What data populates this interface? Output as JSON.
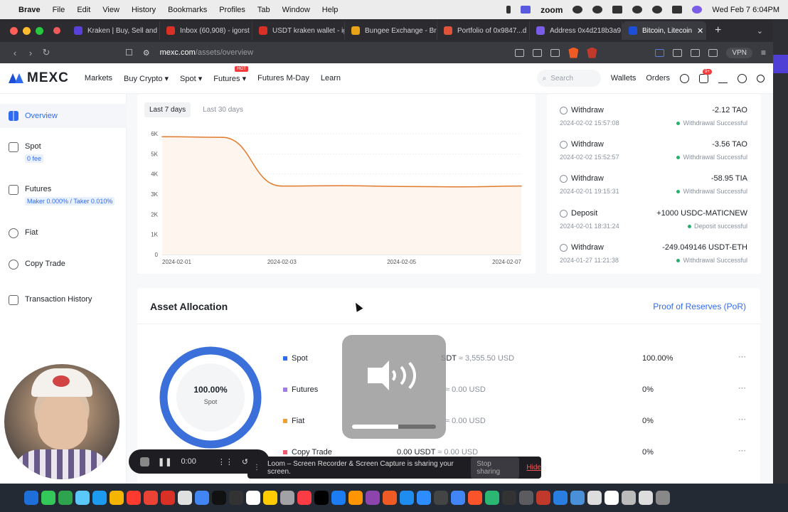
{
  "menubar": {
    "items": [
      "Brave",
      "File",
      "Edit",
      "View",
      "History",
      "Bookmarks",
      "Profiles",
      "Tab",
      "Window",
      "Help"
    ],
    "zoom_label": "zoom",
    "clock": "Wed Feb 7  6:04PM"
  },
  "tabs": [
    {
      "title": "Kraken | Buy, Sell and t",
      "color": "#5841d8"
    },
    {
      "title": "Inbox (60,908) - igorst",
      "color": "#d93025"
    },
    {
      "title": "USDT kraken wallet - ig",
      "color": "#d93025"
    },
    {
      "title": "Bungee Exchange - Bri",
      "color": "#e8a317"
    },
    {
      "title": "Portfolio of 0x9847...d",
      "color": "#e0533b"
    },
    {
      "title": "Address 0x4d218b3a9",
      "color": "#7b5ce6"
    },
    {
      "title": "Bitcoin, Litecoin",
      "color": "#1d4ed8",
      "active": true
    }
  ],
  "address": {
    "host": "mexc.com",
    "path": "/assets/overview",
    "vpn": "VPN"
  },
  "site": {
    "logo": "MEXC",
    "nav": [
      "Markets",
      "Buy Crypto ▾",
      "Spot ▾",
      "Futures ▾",
      "Futures M-Day",
      "Learn"
    ],
    "hot_badge": "HOT",
    "search_placeholder": "Search",
    "wallets": "Wallets",
    "orders": "Orders",
    "msg_badge": "9+"
  },
  "sidebar": [
    {
      "label": "Overview",
      "active": true
    },
    {
      "label": "Spot",
      "sub": "0 fee"
    },
    {
      "label": "Futures",
      "sub": "Maker 0.000% / Taker 0.010%"
    },
    {
      "label": "Fiat"
    },
    {
      "label": "Copy Trade"
    },
    {
      "label": "Transaction History"
    }
  ],
  "range_tabs": {
    "selected": "Last 7 days",
    "other": "Last 30 days"
  },
  "chart_data": {
    "type": "line",
    "x": [
      "2024-02-01",
      "2024-02-02",
      "2024-02-03",
      "2024-02-04",
      "2024-02-05",
      "2024-02-06",
      "2024-02-07"
    ],
    "values": [
      5850,
      5820,
      3400,
      3420,
      3380,
      3360,
      3400
    ],
    "ylim": [
      0,
      6000
    ],
    "yticks": [
      "0",
      "1K",
      "2K",
      "3K",
      "4K",
      "5K",
      "6K"
    ],
    "xtick_labels": [
      "2024-02-01",
      "2024-02-03",
      "2024-02-05",
      "2024-02-07"
    ],
    "color": "#e07b2e"
  },
  "transactions": [
    {
      "type": "Withdraw",
      "date": "2024-02-02 15:57:08",
      "amount": "-2.12 TAO",
      "status": "Withdrawal Successful"
    },
    {
      "type": "Withdraw",
      "date": "2024-02-02 15:52:57",
      "amount": "-3.56 TAO",
      "status": "Withdrawal Successful"
    },
    {
      "type": "Withdraw",
      "date": "2024-02-01 19:15:31",
      "amount": "-58.95 TIA",
      "status": "Withdrawal Successful"
    },
    {
      "type": "Deposit",
      "date": "2024-02-01 18:31:24",
      "amount": "+1000 USDC-MATICNEW",
      "status": "Deposit successful"
    },
    {
      "type": "Withdraw",
      "date": "2024-01-27 11:21:38",
      "amount": "-249.049146 USDT-ETH",
      "status": "Withdrawal Successful"
    }
  ],
  "allocation": {
    "title": "Asset Allocation",
    "por_link": "Proof of Reserves (PoR)",
    "donut_pct": "100.00%",
    "donut_label": "Spot",
    "donut_fraction": 1.0,
    "donut_color": "#3b6fd9",
    "rows": [
      {
        "name": "Spot",
        "value": "SDT",
        "usd": " ≈ 3,555.50 USD",
        "pct": "100.00%",
        "color": "#2f6bf0"
      },
      {
        "name": "Futures",
        "value": "",
        "usd": " ≈ 0.00 USD",
        "pct": "0%",
        "color": "#a27be8"
      },
      {
        "name": "Fiat",
        "value": "",
        "usd": " ≈ 0.00 USD",
        "pct": "0%",
        "color": "#f0a030"
      },
      {
        "name": "Copy Trade",
        "value": "0.00 USDT",
        "usd": " ≈ 0.00 USD",
        "pct": "0%",
        "color": "#ef5a6f"
      }
    ],
    "more": "⋯"
  },
  "volume": {
    "level": 0.55
  },
  "loom": {
    "timer": "0:00",
    "message": "Loom – Screen Recorder & Screen Capture is sharing your screen.",
    "stop": "Stop sharing",
    "hide": "Hide"
  },
  "dock": [
    "#1e6fd9",
    "#34c759",
    "#2ea44f",
    "#5ac8fa",
    "#1d9bf0",
    "#f4b400",
    "#ff3b30",
    "#ea4335",
    "#d93025",
    "#e0e0e0",
    "#4285f4",
    "#111111",
    "#333333",
    "#ffffff",
    "#ffcc00",
    "#a1a1a6",
    "#fc3c44",
    "#000000",
    "#1c7cf4",
    "#ff9500",
    "#8e44ad",
    "#f05a24",
    "#1f8cf0",
    "#2d8cff",
    "#444444",
    "#4285f4",
    "#fb542b",
    "#2bb673",
    "#333333",
    "#5b5b60",
    "#c0392b",
    "#2a7de1",
    "#4a90d9",
    "#dddddd",
    "#ffffff",
    "#bbbbbb",
    "#dddddd",
    "#888888"
  ]
}
